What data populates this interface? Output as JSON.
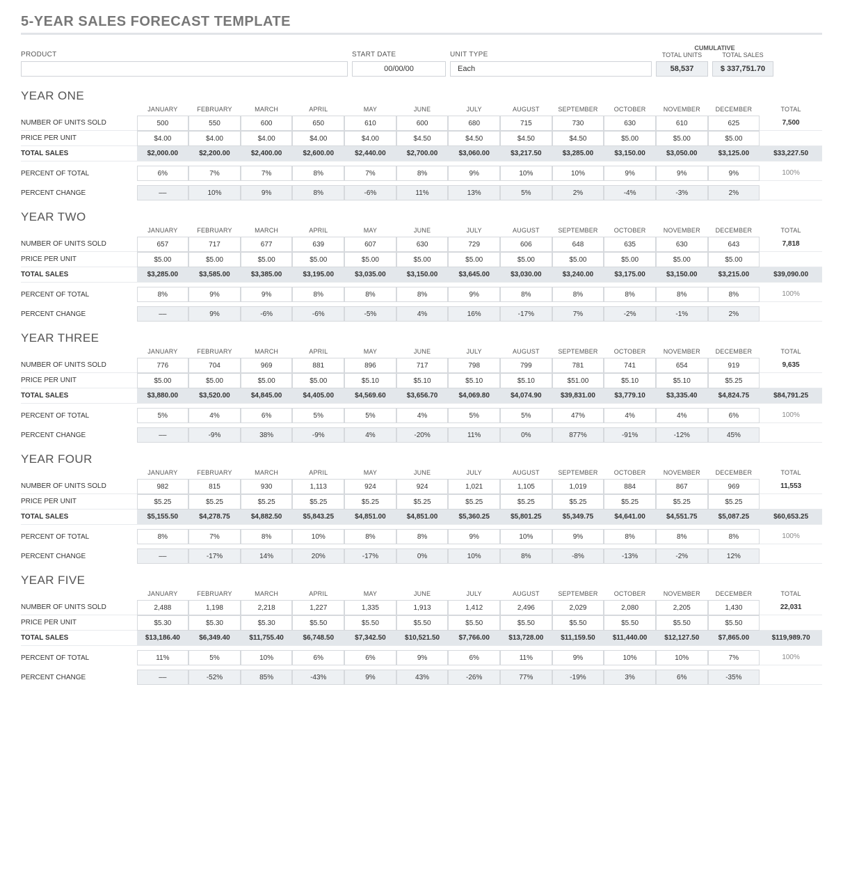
{
  "title": "5-YEAR SALES FORECAST TEMPLATE",
  "hdr": {
    "product": "PRODUCT",
    "start_date": "START DATE",
    "unit_type": "UNIT TYPE",
    "cumulative": "CUMULATIVE",
    "total_units": "TOTAL UNITS",
    "total_sales": "TOTAL SALES",
    "product_val": "",
    "start_date_val": "00/00/00",
    "unit_type_val": "Each",
    "cum_units": "58,537",
    "cum_sales": "$  337,751.70"
  },
  "months": [
    "JANUARY",
    "FEBRUARY",
    "MARCH",
    "APRIL",
    "MAY",
    "JUNE",
    "JULY",
    "AUGUST",
    "SEPTEMBER",
    "OCTOBER",
    "NOVEMBER",
    "DECEMBER",
    "TOTAL"
  ],
  "row_labels": {
    "units": "NUMBER OF UNITS SOLD",
    "price": "PRICE PER UNIT",
    "sales": "TOTAL SALES",
    "pct": "PERCENT OF TOTAL",
    "chg": "PERCENT CHANGE"
  },
  "years": [
    {
      "name": "YEAR ONE",
      "units": [
        "500",
        "550",
        "600",
        "650",
        "610",
        "600",
        "680",
        "715",
        "730",
        "630",
        "610",
        "625",
        "7,500"
      ],
      "price": [
        "$4.00",
        "$4.00",
        "$4.00",
        "$4.00",
        "$4.00",
        "$4.50",
        "$4.50",
        "$4.50",
        "$4.50",
        "$5.00",
        "$5.00",
        "$5.00",
        ""
      ],
      "sales": [
        "$2,000.00",
        "$2,200.00",
        "$2,400.00",
        "$2,600.00",
        "$2,440.00",
        "$2,700.00",
        "$3,060.00",
        "$3,217.50",
        "$3,285.00",
        "$3,150.00",
        "$3,050.00",
        "$3,125.00",
        "$33,227.50"
      ],
      "pct": [
        "6%",
        "7%",
        "7%",
        "8%",
        "7%",
        "8%",
        "9%",
        "10%",
        "10%",
        "9%",
        "9%",
        "9%",
        "100%"
      ],
      "chg": [
        "––",
        "10%",
        "9%",
        "8%",
        "-6%",
        "11%",
        "13%",
        "5%",
        "2%",
        "-4%",
        "-3%",
        "2%",
        ""
      ]
    },
    {
      "name": "YEAR TWO",
      "units": [
        "657",
        "717",
        "677",
        "639",
        "607",
        "630",
        "729",
        "606",
        "648",
        "635",
        "630",
        "643",
        "7,818"
      ],
      "price": [
        "$5.00",
        "$5.00",
        "$5.00",
        "$5.00",
        "$5.00",
        "$5.00",
        "$5.00",
        "$5.00",
        "$5.00",
        "$5.00",
        "$5.00",
        "$5.00",
        ""
      ],
      "sales": [
        "$3,285.00",
        "$3,585.00",
        "$3,385.00",
        "$3,195.00",
        "$3,035.00",
        "$3,150.00",
        "$3,645.00",
        "$3,030.00",
        "$3,240.00",
        "$3,175.00",
        "$3,150.00",
        "$3,215.00",
        "$39,090.00"
      ],
      "pct": [
        "8%",
        "9%",
        "9%",
        "8%",
        "8%",
        "8%",
        "9%",
        "8%",
        "8%",
        "8%",
        "8%",
        "8%",
        "100%"
      ],
      "chg": [
        "––",
        "9%",
        "-6%",
        "-6%",
        "-5%",
        "4%",
        "16%",
        "-17%",
        "7%",
        "-2%",
        "-1%",
        "2%",
        ""
      ]
    },
    {
      "name": "YEAR THREE",
      "units": [
        "776",
        "704",
        "969",
        "881",
        "896",
        "717",
        "798",
        "799",
        "781",
        "741",
        "654",
        "919",
        "9,635"
      ],
      "price": [
        "$5.00",
        "$5.00",
        "$5.00",
        "$5.00",
        "$5.10",
        "$5.10",
        "$5.10",
        "$5.10",
        "$51.00",
        "$5.10",
        "$5.10",
        "$5.25",
        ""
      ],
      "sales": [
        "$3,880.00",
        "$3,520.00",
        "$4,845.00",
        "$4,405.00",
        "$4,569.60",
        "$3,656.70",
        "$4,069.80",
        "$4,074.90",
        "$39,831.00",
        "$3,779.10",
        "$3,335.40",
        "$4,824.75",
        "$84,791.25"
      ],
      "pct": [
        "5%",
        "4%",
        "6%",
        "5%",
        "5%",
        "4%",
        "5%",
        "5%",
        "47%",
        "4%",
        "4%",
        "6%",
        "100%"
      ],
      "chg": [
        "––",
        "-9%",
        "38%",
        "-9%",
        "4%",
        "-20%",
        "11%",
        "0%",
        "877%",
        "-91%",
        "-12%",
        "45%",
        ""
      ]
    },
    {
      "name": "YEAR FOUR",
      "units": [
        "982",
        "815",
        "930",
        "1,113",
        "924",
        "924",
        "1,021",
        "1,105",
        "1,019",
        "884",
        "867",
        "969",
        "11,553"
      ],
      "price": [
        "$5.25",
        "$5.25",
        "$5.25",
        "$5.25",
        "$5.25",
        "$5.25",
        "$5.25",
        "$5.25",
        "$5.25",
        "$5.25",
        "$5.25",
        "$5.25",
        ""
      ],
      "sales": [
        "$5,155.50",
        "$4,278.75",
        "$4,882.50",
        "$5,843.25",
        "$4,851.00",
        "$4,851.00",
        "$5,360.25",
        "$5,801.25",
        "$5,349.75",
        "$4,641.00",
        "$4,551.75",
        "$5,087.25",
        "$60,653.25"
      ],
      "pct": [
        "8%",
        "7%",
        "8%",
        "10%",
        "8%",
        "8%",
        "9%",
        "10%",
        "9%",
        "8%",
        "8%",
        "8%",
        "100%"
      ],
      "chg": [
        "––",
        "-17%",
        "14%",
        "20%",
        "-17%",
        "0%",
        "10%",
        "8%",
        "-8%",
        "-13%",
        "-2%",
        "12%",
        ""
      ]
    },
    {
      "name": "YEAR FIVE",
      "units": [
        "2,488",
        "1,198",
        "2,218",
        "1,227",
        "1,335",
        "1,913",
        "1,412",
        "2,496",
        "2,029",
        "2,080",
        "2,205",
        "1,430",
        "22,031"
      ],
      "price": [
        "$5.30",
        "$5.30",
        "$5.30",
        "$5.50",
        "$5.50",
        "$5.50",
        "$5.50",
        "$5.50",
        "$5.50",
        "$5.50",
        "$5.50",
        "$5.50",
        ""
      ],
      "sales": [
        "$13,186.40",
        "$6,349.40",
        "$11,755.40",
        "$6,748.50",
        "$7,342.50",
        "$10,521.50",
        "$7,766.00",
        "$13,728.00",
        "$11,159.50",
        "$11,440.00",
        "$12,127.50",
        "$7,865.00",
        "$119,989.70"
      ],
      "pct": [
        "11%",
        "5%",
        "10%",
        "6%",
        "6%",
        "9%",
        "6%",
        "11%",
        "9%",
        "10%",
        "10%",
        "7%",
        "100%"
      ],
      "chg": [
        "––",
        "-52%",
        "85%",
        "-43%",
        "9%",
        "43%",
        "-26%",
        "77%",
        "-19%",
        "3%",
        "6%",
        "-35%",
        ""
      ]
    }
  ]
}
